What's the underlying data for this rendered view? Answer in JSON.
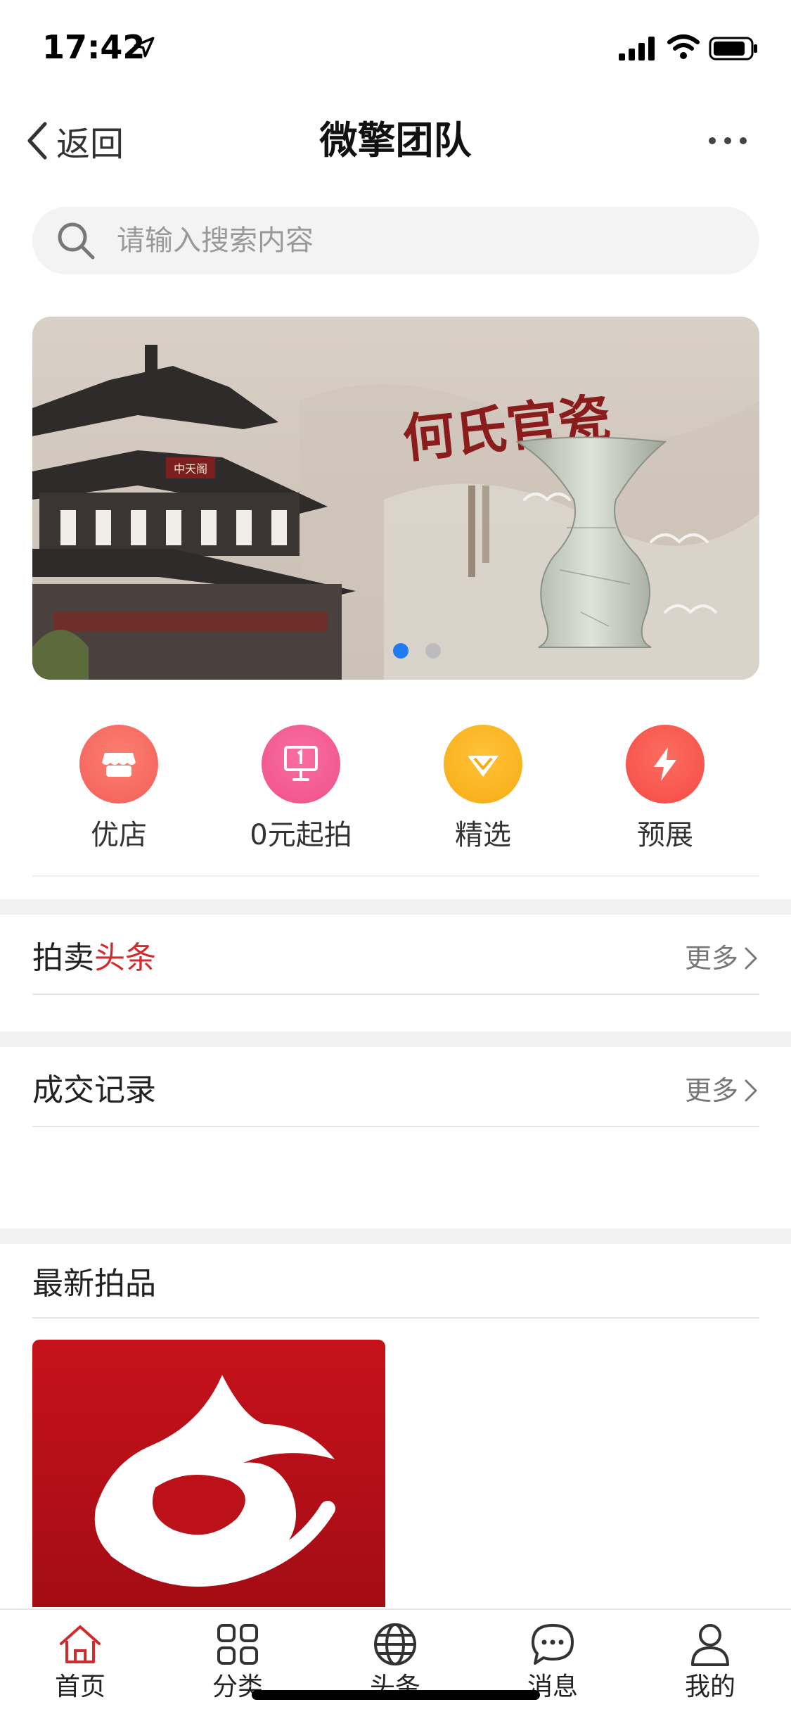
{
  "status_bar": {
    "time": "17:42"
  },
  "nav": {
    "back_label": "返回",
    "title": "微擎团队"
  },
  "search": {
    "placeholder": "请输入搜索内容"
  },
  "banner": {
    "brand_text": "何氏官瓷",
    "plaque_text": "中天阁",
    "slide_count": 2,
    "active_slide": 1
  },
  "quick_entries": [
    {
      "label": "优店",
      "icon": "shop-icon",
      "color": "#f45f58"
    },
    {
      "label": "0元起拍",
      "icon": "auction-sign-icon",
      "color": "#f0508a"
    },
    {
      "label": "精选",
      "icon": "diamond-icon",
      "color": "#f6ac12"
    },
    {
      "label": "预展",
      "icon": "lightning-icon",
      "color": "#f64a44"
    }
  ],
  "sections": {
    "headlines": {
      "title_prefix": "拍卖",
      "title_highlight": "头条",
      "more": "更多"
    },
    "deals": {
      "title": "成交记录",
      "more": "更多"
    },
    "latest": {
      "title": "最新拍品"
    }
  },
  "tab_bar": {
    "items": [
      {
        "label": "首页",
        "icon": "home-icon",
        "active": true
      },
      {
        "label": "分类",
        "icon": "grid-icon"
      },
      {
        "label": "头条",
        "icon": "globe-icon"
      },
      {
        "label": "消息",
        "icon": "chat-icon"
      },
      {
        "label": "我的",
        "icon": "user-icon"
      }
    ]
  },
  "colors": {
    "accent_red": "#d12b2f",
    "active_dot": "#1f7bf2"
  }
}
